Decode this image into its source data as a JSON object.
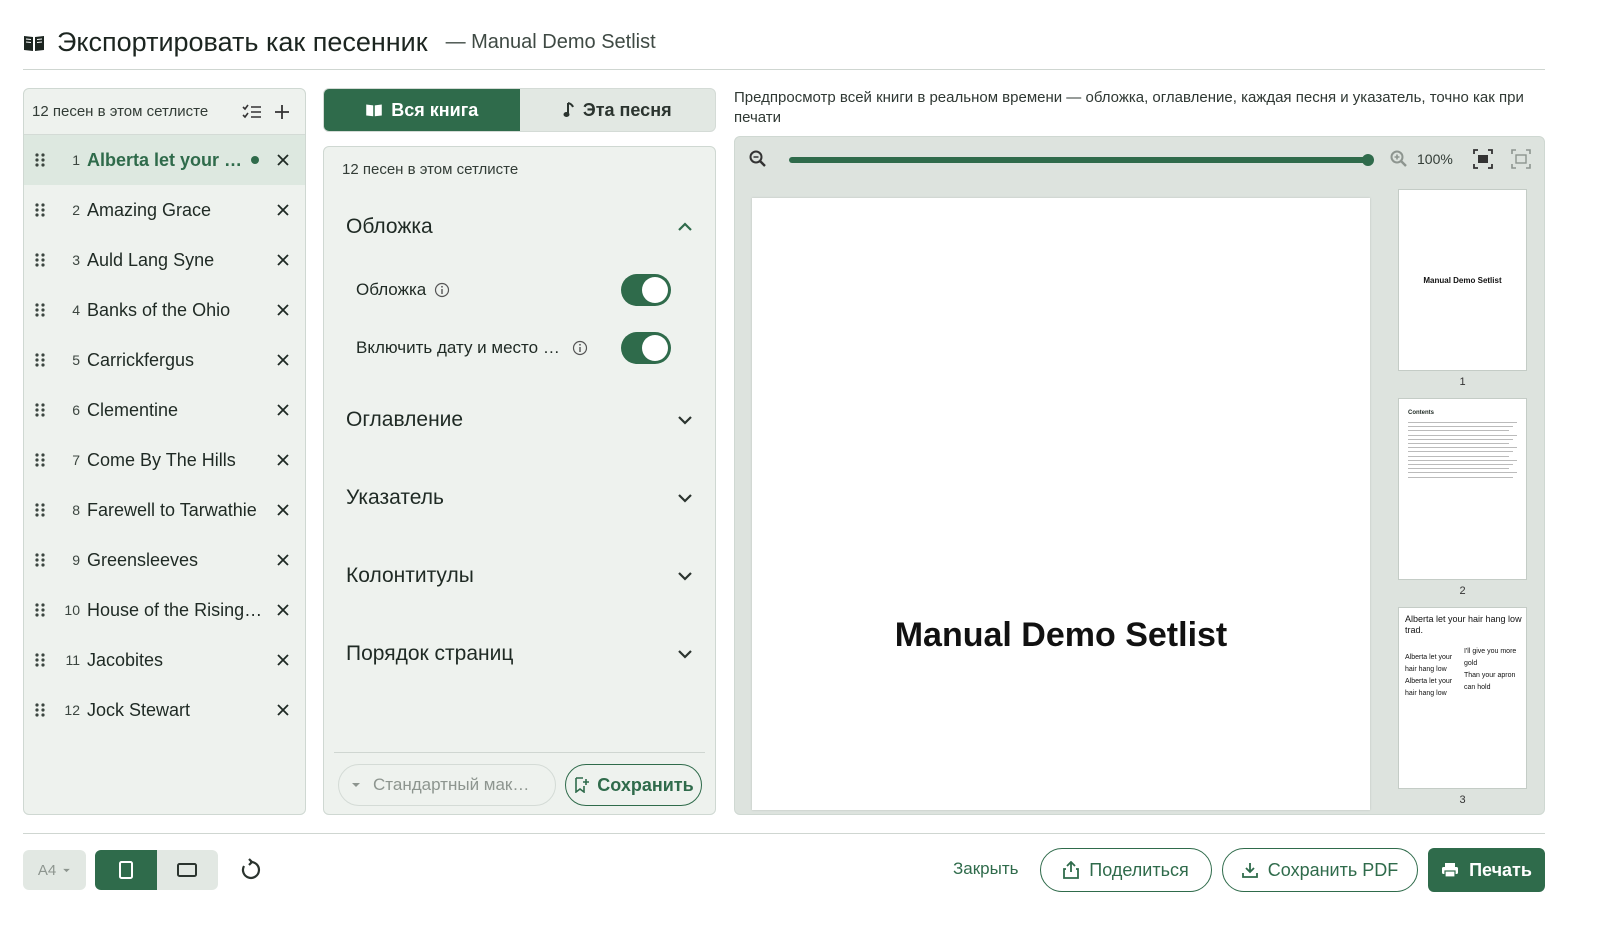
{
  "header": {
    "title": "Экспортировать как песенник",
    "subtitle": "— Manual Demo Setlist"
  },
  "setlist": {
    "count_label": "12 песен в этом сетлисте",
    "songs": [
      {
        "num": "1",
        "title": "Alberta let your hair hang low",
        "active": true
      },
      {
        "num": "2",
        "title": "Amazing Grace"
      },
      {
        "num": "3",
        "title": "Auld Lang Syne"
      },
      {
        "num": "4",
        "title": "Banks of the Ohio"
      },
      {
        "num": "5",
        "title": "Carrickfergus"
      },
      {
        "num": "6",
        "title": "Clementine"
      },
      {
        "num": "7",
        "title": "Come By The Hills"
      },
      {
        "num": "8",
        "title": "Farewell to Tarwathie"
      },
      {
        "num": "9",
        "title": "Greensleeves"
      },
      {
        "num": "10",
        "title": "House of the Rising Sun"
      },
      {
        "num": "11",
        "title": "Jacobites"
      },
      {
        "num": "12",
        "title": "Jock Stewart"
      }
    ]
  },
  "tabs": {
    "whole_book": "Вся книга",
    "this_song": "Эта песня"
  },
  "settings": {
    "count_label": "12 песен в этом сетлисте",
    "cover_section": "Обложка",
    "cover_toggle_label": "Обложка",
    "cover_toggle_on": true,
    "date_toggle_label": "Включить дату и место …",
    "date_toggle_on": true,
    "toc_section": "Оглавление",
    "index_section": "Указатель",
    "headers_section": "Колонтитулы",
    "page_order_section": "Порядок страниц",
    "preset_placeholder": "Стандартный мак…",
    "save_label": "Сохранить"
  },
  "preview": {
    "description": "Предпросмотр всей книги в реальном времени — обложка, оглавление, каждая песня и указатель, точно как при печати",
    "zoom_percent": "100%",
    "zoom_slider_value": 1.0,
    "page_title": "Manual Demo Setlist",
    "thumbnails": [
      {
        "num": "1",
        "title": "Manual Demo Setlist"
      },
      {
        "num": "2",
        "title": "Contents"
      },
      {
        "num": "3",
        "title": "Alberta let your hair hang low",
        "subtitle": "trad.",
        "col1": [
          "Alberta let your",
          "hair hang low",
          "Alberta let your",
          "hair hang low"
        ],
        "col2": [
          "I'll give you more",
          "gold",
          "Than your apron",
          "can hold"
        ]
      }
    ]
  },
  "bottom": {
    "paper_size": "A4",
    "close_label": "Закрыть",
    "share_label": "Поделиться",
    "save_pdf_label": "Сохранить PDF",
    "print_label": "Печать"
  },
  "colors": {
    "accent": "#2f6b4b",
    "panel_bg": "#eef2ee",
    "preview_bg": "#dde3de"
  }
}
